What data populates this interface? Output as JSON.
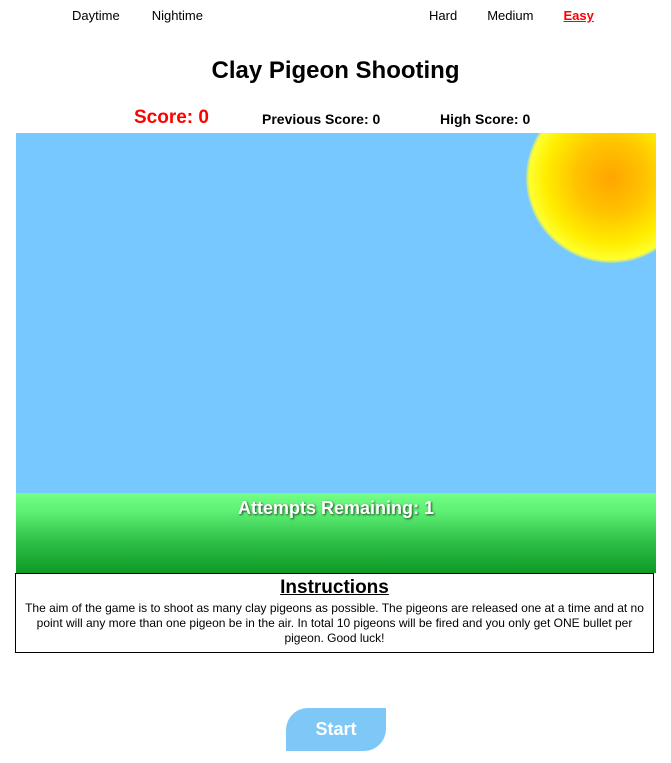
{
  "nav": {
    "time_modes": [
      "Daytime",
      "Nightime"
    ],
    "difficulties": [
      "Hard",
      "Medium",
      "Easy"
    ],
    "active_difficulty": "Easy"
  },
  "title": "Clay Pigeon Shooting",
  "scores": {
    "score": "Score: 0",
    "previous": "Previous Score: 0",
    "high": "High Score: 0"
  },
  "game": {
    "attempts": "Attempts Remaining: 1"
  },
  "instructions": {
    "heading": "Instructions",
    "body": "The aim of the game is to shoot as many clay pigeons as possible. The pigeons are released one at a time and at no point will any more than one pigeon be in the air. In total 10 pigeons will be fired and you only get ONE bullet per pigeon. Good luck!"
  },
  "start_label": "Start",
  "colors": {
    "sky": "#77c8ff",
    "score": "#ff0000",
    "button": "#7ec8f8"
  }
}
